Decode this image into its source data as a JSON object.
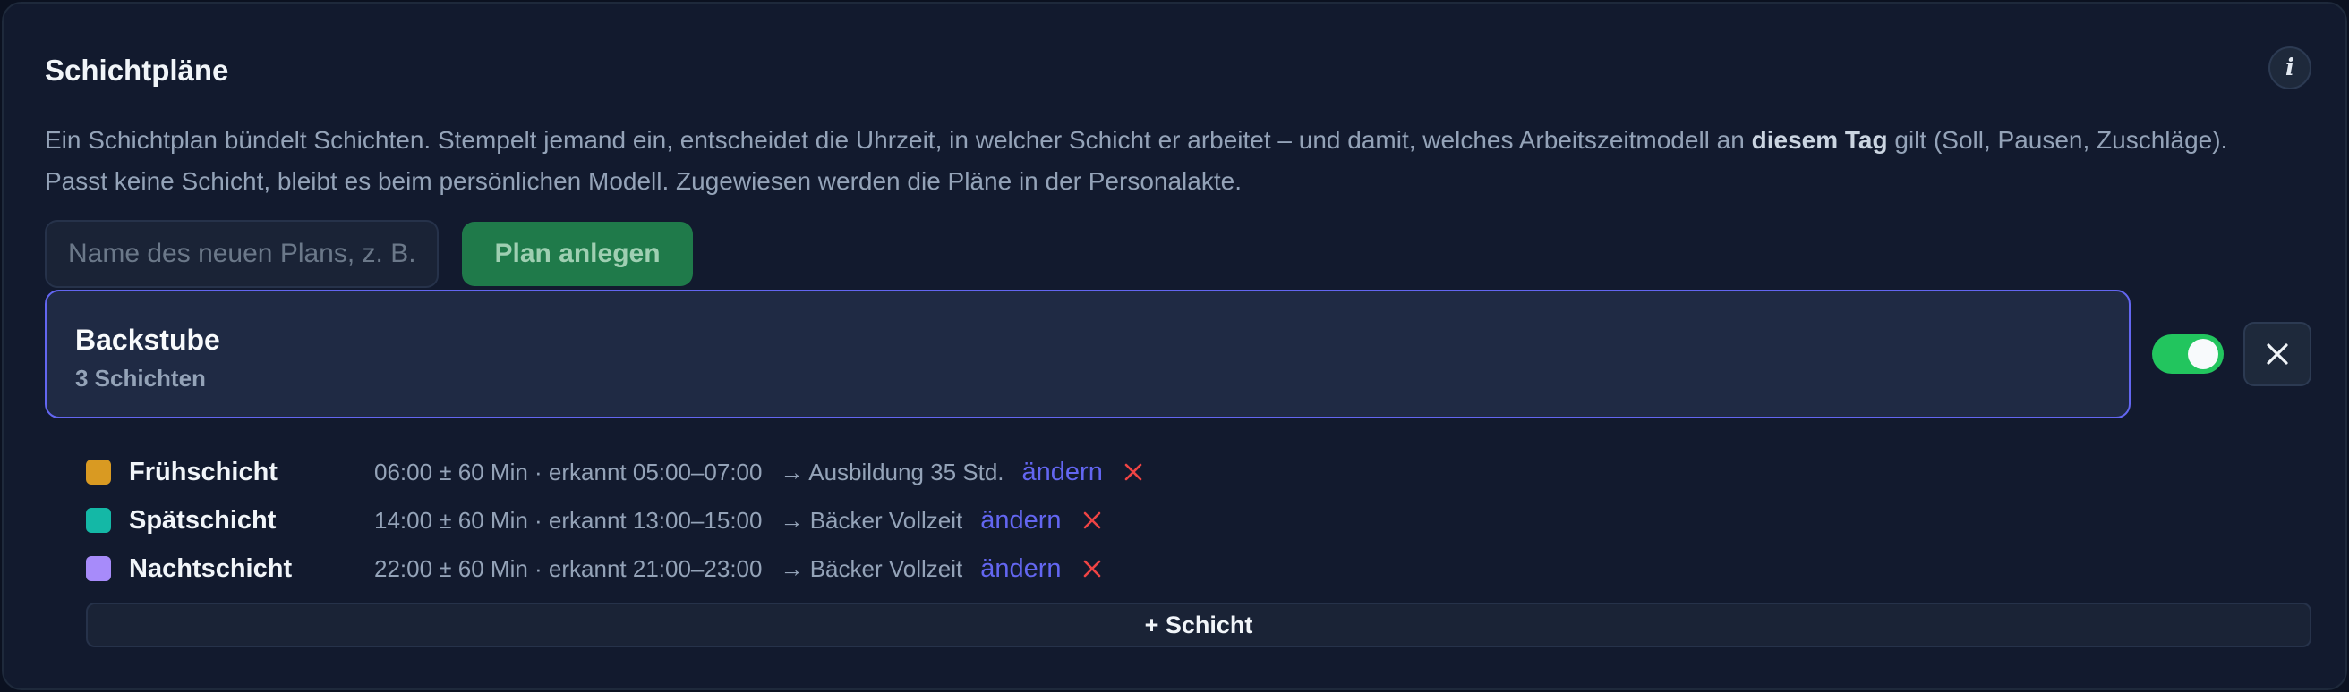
{
  "panel": {
    "title": "Schichtpläne",
    "info_label": "i",
    "description_part1": "Ein Schichtplan bündelt Schichten. Stempelt jemand ein, entscheidet die Uhrzeit, in welcher Schicht er arbeitet – und damit, welches Arbeitszeitmodell an ",
    "description_bold": "diesem Tag",
    "description_part2": " gilt (Soll, Pausen, Zuschläge). Passt keine Schicht, bleibt es beim persönlichen Modell. Zugewiesen werden die Pläne in der Personalakte."
  },
  "new_plan": {
    "value": "",
    "placeholder": "Name des neuen Plans, z. B. Backstube",
    "create_label": "Plan anlegen"
  },
  "plan": {
    "name": "Backstube",
    "subtitle": "3 Schichten",
    "active": true
  },
  "shifts": [
    {
      "name": "Frühschicht",
      "color": "#d99a22",
      "info": "06:00 ± 60 Min · erkannt 05:00–07:00",
      "model": "→ Ausbildung 35 Std.",
      "edit_label": "ändern"
    },
    {
      "name": "Spätschicht",
      "color": "#14b8a6",
      "info": "14:00 ± 60 Min · erkannt 13:00–15:00",
      "model": "→ Bäcker Vollzeit",
      "edit_label": "ändern"
    },
    {
      "name": "Nachtschicht",
      "color": "#a78bfa",
      "info": "22:00 ± 60 Min · erkannt 21:00–23:00",
      "model": "→ Bäcker Vollzeit",
      "edit_label": "ändern"
    }
  ],
  "add_shift_label": "+ Schicht",
  "colors": {
    "accent": "#6366f1",
    "toggle_on": "#22c55e",
    "create_button": "#1f7a4a",
    "remove": "#ef4444"
  },
  "icons": {
    "info": "info-icon",
    "close": "close-icon",
    "remove": "remove-icon"
  }
}
